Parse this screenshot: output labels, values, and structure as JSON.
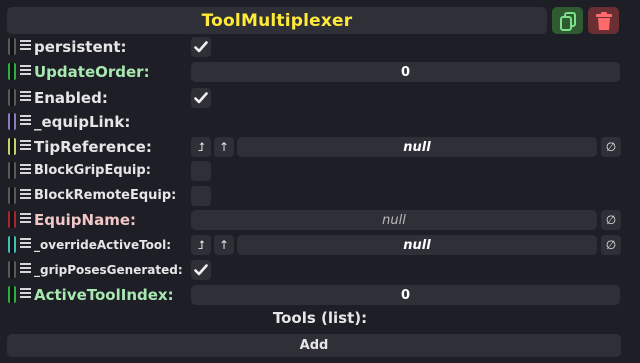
{
  "header": {
    "title": "ToolMultiplexer",
    "duplicate_icon": "duplicate-icon",
    "delete_icon": "trash-icon"
  },
  "fields": {
    "persistent": {
      "label": "persistent:",
      "value": true
    },
    "update_order": {
      "label": "UpdateOrder:",
      "value": "0"
    },
    "enabled": {
      "label": "Enabled:",
      "value": true
    },
    "equip_link": {
      "label": "_equipLink:"
    },
    "tip_reference": {
      "label": "TipReference:",
      "value": "null"
    },
    "block_grip_equip": {
      "label": "BlockGripEquip:",
      "value": false
    },
    "block_remote_equip": {
      "label": "BlockRemoteEquip:",
      "value": false
    },
    "equip_name": {
      "label": "EquipName:",
      "value": "null"
    },
    "override_active_tool": {
      "label": "_overrideActiveTool:",
      "value": "null"
    },
    "grip_poses_generated": {
      "label": "_gripPosesGenerated:",
      "value": true
    },
    "active_tool_index": {
      "label": "ActiveToolIndex:",
      "value": "0"
    }
  },
  "list": {
    "label": "Tools (list):",
    "add_label": "Add"
  },
  "buttons": {
    "jump_icon": "⮥",
    "up_icon": "↑",
    "null_icon": "∅"
  },
  "colors": {
    "header_title": "#ffea3a",
    "label_default": "#e6e6e6",
    "label_int": "#a8e7b0",
    "label_string": "#f1c7c7",
    "connector_bool": "#5a5a5a",
    "connector_int": "#2fae44",
    "connector_ref": "#8a7cc0",
    "connector_slot": "#c7d46b",
    "connector_string": "#a3282f",
    "connector_tool": "#43bfb4"
  }
}
